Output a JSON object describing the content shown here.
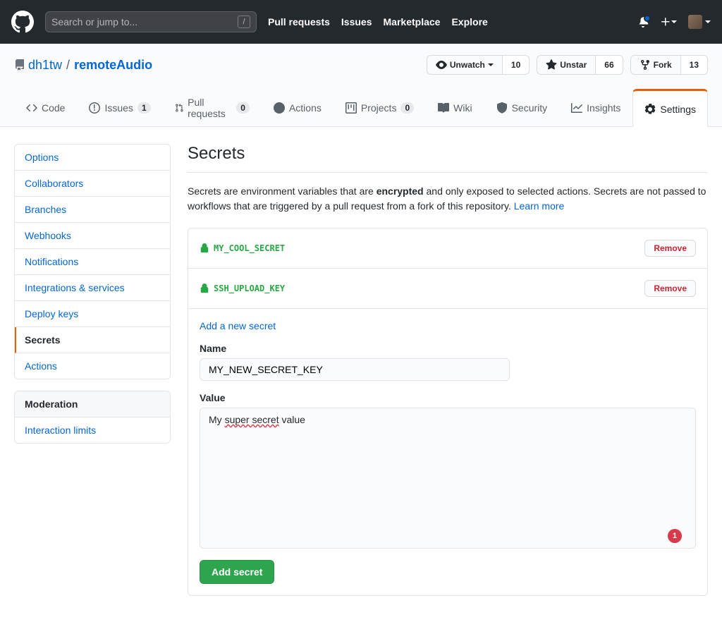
{
  "header": {
    "search_placeholder": "Search or jump to...",
    "nav": {
      "pulls": "Pull requests",
      "issues": "Issues",
      "marketplace": "Marketplace",
      "explore": "Explore"
    }
  },
  "repo": {
    "owner": "dh1tw",
    "name": "remoteAudio",
    "watch": {
      "label": "Unwatch",
      "count": "10"
    },
    "star": {
      "label": "Unstar",
      "count": "66"
    },
    "fork": {
      "label": "Fork",
      "count": "13"
    }
  },
  "tabs": {
    "code": "Code",
    "issues": "Issues",
    "issues_count": "1",
    "pulls": "Pull requests",
    "pulls_count": "0",
    "actions": "Actions",
    "projects": "Projects",
    "projects_count": "0",
    "wiki": "Wiki",
    "security": "Security",
    "insights": "Insights",
    "settings": "Settings"
  },
  "sidebar": {
    "items": [
      "Options",
      "Collaborators",
      "Branches",
      "Webhooks",
      "Notifications",
      "Integrations & services",
      "Deploy keys",
      "Secrets",
      "Actions"
    ],
    "moderation_header": "Moderation",
    "interaction_limits": "Interaction limits"
  },
  "page": {
    "title": "Secrets",
    "desc_prefix": "Secrets are environment variables that are ",
    "desc_bold": "encrypted",
    "desc_mid": " and only exposed to selected actions. Secrets are not passed to workflows that are triggered by a pull request from a fork of this repository. ",
    "learn_more": "Learn more",
    "secrets": [
      {
        "name": "MY_COOL_SECRET"
      },
      {
        "name": "SSH_UPLOAD_KEY"
      }
    ],
    "remove_label": "Remove",
    "add_link": "Add a new secret",
    "name_label": "Name",
    "name_value": "MY_NEW_SECRET_KEY",
    "value_label": "Value",
    "value_prefix": "My ",
    "value_spell": "super secret",
    "value_suffix": " value",
    "grammar_count": "1",
    "submit": "Add secret"
  }
}
